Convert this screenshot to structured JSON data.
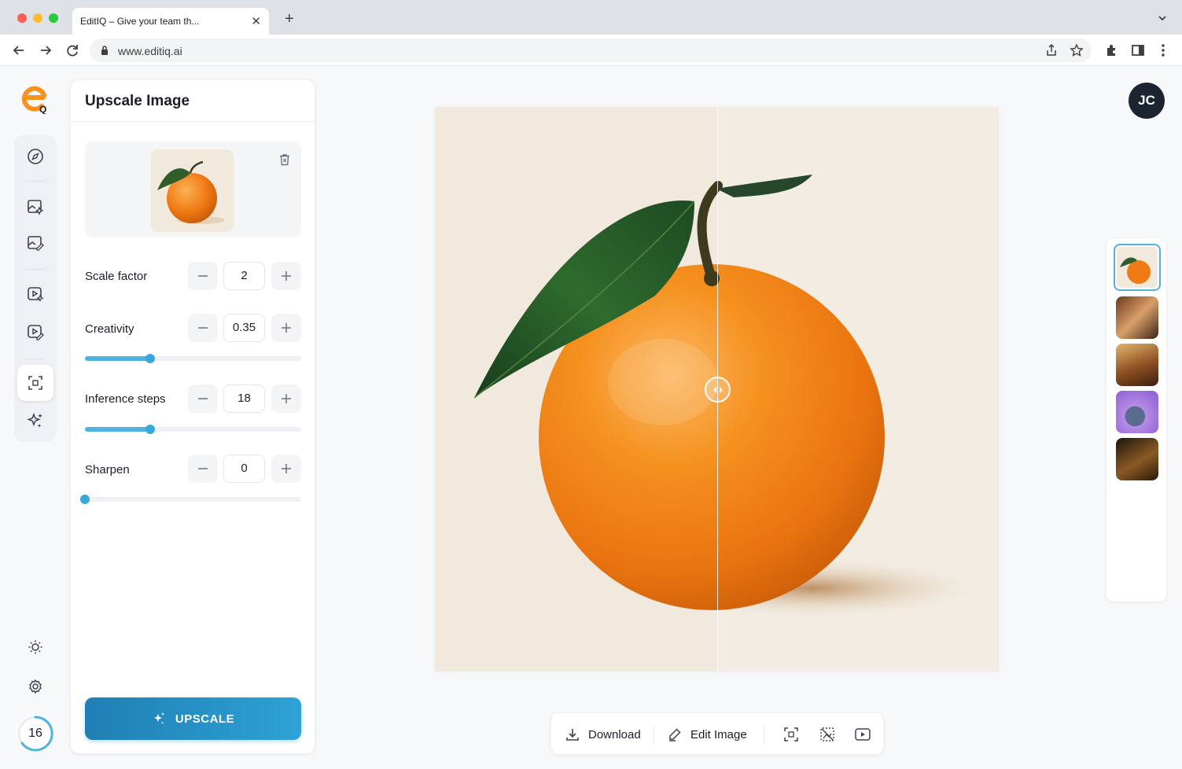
{
  "browser": {
    "tab_title": "EditIQ – Give your team th...",
    "url": "www.editiq.ai",
    "traffic_lights": [
      "#ff5f57",
      "#febc2e",
      "#28c840"
    ]
  },
  "app": {
    "logo_letters": "Q",
    "avatar_initials": "JC",
    "credits": "16",
    "accent": "#2ea2d6",
    "rail_icons": [
      "compass-icon",
      "image-sparkle-icon",
      "image-edit-icon",
      "video-sparkle-icon",
      "video-edit-icon",
      "upscale-frame-icon",
      "sparkles-icon"
    ],
    "active_rail_item": "upscale-frame-icon"
  },
  "panel": {
    "title": "Upscale Image",
    "controls": [
      {
        "label": "Scale factor",
        "value": "2"
      },
      {
        "label": "Creativity",
        "value": "0.35",
        "slider_percent": 30
      },
      {
        "label": "Inference steps",
        "value": "18",
        "slider_percent": 30
      },
      {
        "label": "Sharpen",
        "value": "0",
        "slider_percent": 0
      }
    ],
    "button_label": "UPSCALE"
  },
  "actions": {
    "download": "Download",
    "edit_image": "Edit Image",
    "extra_icons": [
      "frame-icon",
      "remove-bg-icon",
      "video-play-icon"
    ]
  },
  "history": {
    "items": [
      "orange",
      "cafe-scene",
      "interior-scene",
      "purple-creature",
      "dark-room"
    ],
    "selected": 0
  }
}
